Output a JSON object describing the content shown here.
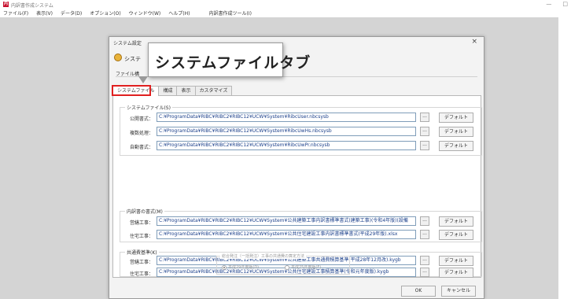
{
  "app": {
    "title": "内訳書作成システム",
    "minimize_glyph": "—",
    "maximize_glyph": "□"
  },
  "menu": [
    "ファイル(F)",
    "表示(V)",
    "データ(D)",
    "オプション(O)",
    "ウィンドウ(W)",
    "ヘルプ(H)",
    "内訳書作成ツール(I)"
  ],
  "dialog": {
    "title": "システム設定",
    "heading": "システ",
    "sub_label": "ファイル構",
    "close_glyph": "×",
    "tabs": [
      {
        "label": "システムファイル",
        "active": true
      },
      {
        "label": "構成",
        "active": false
      },
      {
        "label": "表示",
        "active": false
      },
      {
        "label": "カスタマイズ",
        "active": false
      }
    ],
    "system_files": {
      "label": "システムファイル(S)",
      "rows": [
        {
          "label": "公開書式：",
          "path": "C:¥ProgramData¥RIBC¥RIBC2¥RIBC12¥UCW¥System¥RibcUser.nbcsysb"
        },
        {
          "label": "複数処理：",
          "path": "C:¥ProgramData¥RIBC¥RIBC2¥RIBC12¥UCW¥System¥RibcUwHs.nbcsysb"
        },
        {
          "label": "自動書式：",
          "path": "C:¥ProgramData¥RIBC¥RIBC2¥RIBC12¥UCW¥System¥RibcUwPr.nbcsysb"
        }
      ]
    },
    "breakdown_format": {
      "label": "内訳書の書式(M)",
      "rows": [
        {
          "label": "営繕工事：",
          "path": "C:¥ProgramData¥RIBC¥RIBC2¥RIBC12¥UCW¥System¥公共建築工事内訳書標準書式(建築工事)(令和4年版)(設備"
        },
        {
          "label": "住宅工事：",
          "path": "C:¥ProgramData¥RIBC¥RIBC2¥RIBC12¥UCW¥System¥公共住宅建設工事内訳書標準書式(平成29年版).xlsx"
        }
      ]
    },
    "common_standard": {
      "label": "共通費基準(K)",
      "rows": [
        {
          "label": "営繕工事：",
          "path": "C:¥ProgramData¥RIBC¥RIBC2¥RIBC12¥UCW¥System¥公共建築工事共通費積算基準(平成28年12月改).kygb"
        },
        {
          "label": "住宅工事：",
          "path": "C:¥ProgramData¥RIBC¥RIBC2¥RIBC12¥UCW¥System¥公共住宅建設工事積算基準(令和元年度版).kygb"
        }
      ],
      "method": {
        "label": "総合発注（一括発注）工事の共通費の算定方法",
        "options": [
          {
            "label": "平成29年度版(D)",
            "checked": true
          },
          {
            "label": "平成25年度版(F)",
            "checked": false
          }
        ]
      }
    },
    "browse_label": "...",
    "default_label": "デフォルト",
    "ok_label": "OK",
    "cancel_label": "キャンセル"
  },
  "callout": {
    "text": "システムファイルタブ",
    "highlight_color": "#e02020"
  }
}
